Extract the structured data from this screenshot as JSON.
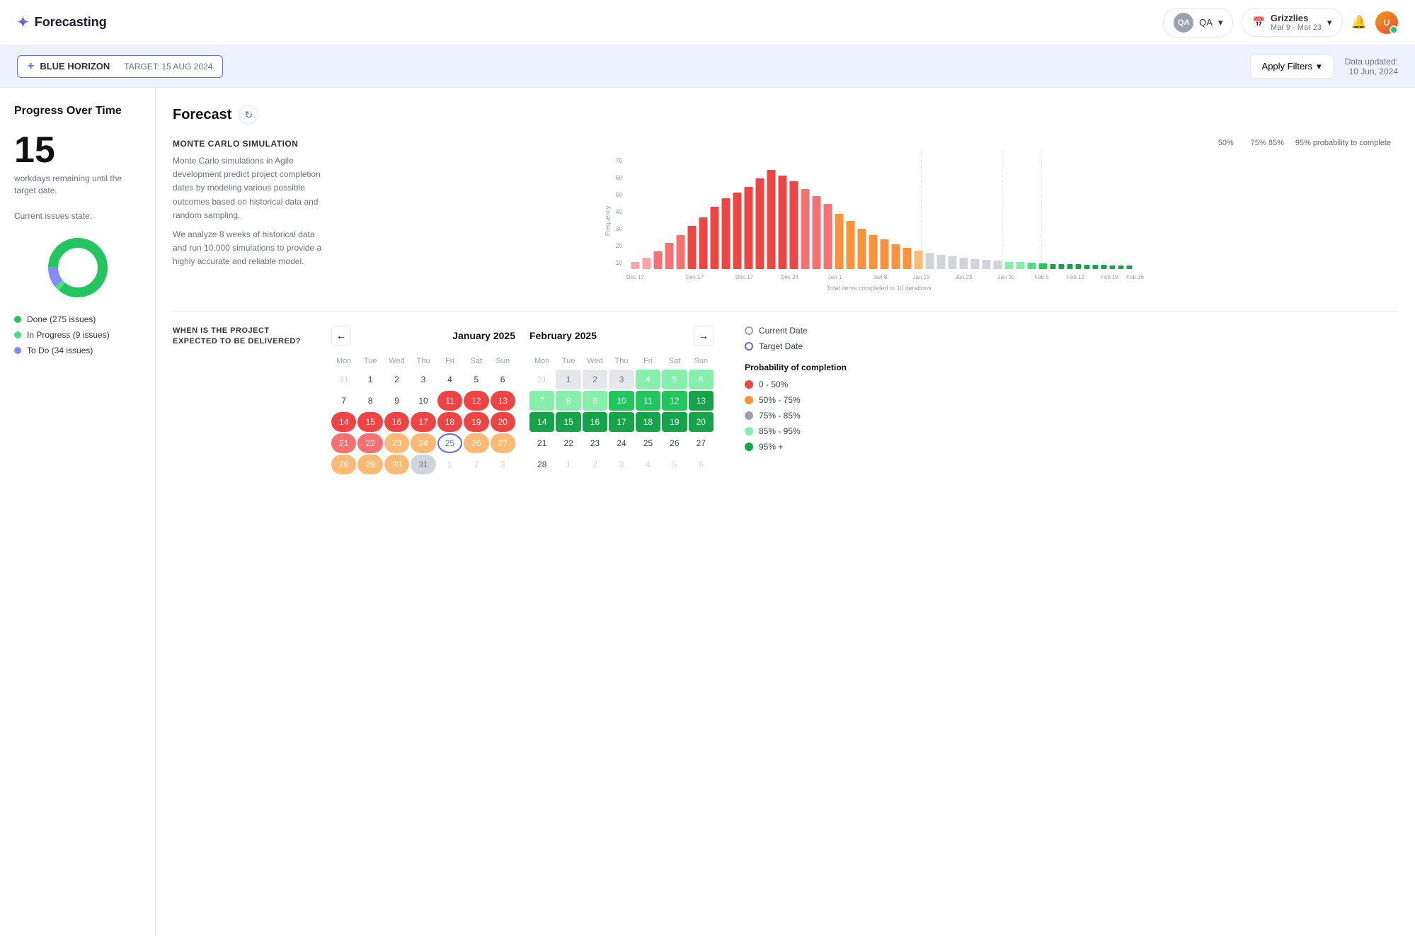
{
  "header": {
    "title": "Forecasting",
    "logo_icon": "✦",
    "team_avatar": "QA",
    "team_name": "QA",
    "calendar_icon": "📅",
    "project_name": "Grizzlies",
    "project_dates": "Mar 9 - Mar 23",
    "chevron_down": "▾"
  },
  "sub_header": {
    "plus_icon": "+",
    "project_tag": "BLUE HORIZON",
    "target_label": "TARGET: 15 AUG 2024",
    "apply_filters": "Apply Filters",
    "data_updated_label": "Data updated:",
    "data_updated_date": "10 Jun, 2024"
  },
  "left_panel": {
    "title": "Progress Over Time",
    "workdays_number": "15",
    "workdays_desc": "workdays remaining until the target date.",
    "current_issues_label": "Current issues state:",
    "legend": [
      {
        "color": "#22c55e",
        "label": "Done (275 issues)"
      },
      {
        "color": "#4ade80",
        "label": "In Progress (9 issues)"
      },
      {
        "color": "#818cf8",
        "label": "To Do (34 issues)"
      }
    ],
    "donut": {
      "done_pct": 86,
      "in_progress_pct": 3,
      "todo_pct": 11
    }
  },
  "forecast": {
    "title": "Forecast",
    "refresh_icon": "↻",
    "monte_carlo": {
      "title": "MONTE CARLO SIMULATION",
      "desc1": "Monte Carlo simulations in Agile development predict project completion dates by modeling various possible outcomes based on historical data and random sampling.",
      "desc2": "We analyze 8 weeks of historical data and run 10,000 simulations to provide a highly accurate and reliable model."
    },
    "chart": {
      "y_label": "Frequency",
      "x_label": "Total items completed in 10 iterations",
      "y_ticks": [
        70,
        60,
        50,
        40,
        30,
        20,
        10
      ],
      "x_labels": [
        "Dec 17",
        "Dec 17",
        "Dec 17",
        "Dec 24",
        "Jan 1",
        "Jan 8",
        "Jan 15",
        "Jan 23",
        "Jan 30",
        "Feb 5",
        "Feb 12",
        "Feb 19",
        "Feb 26"
      ],
      "probability_labels": [
        "50%",
        "75%",
        "85%",
        "95% probability to complete"
      ]
    },
    "delivery_section": {
      "question": "WHEN IS THE PROJECT EXPECTED TO BE DELIVERED?",
      "jan_2025": {
        "month": "January 2025",
        "days_header": [
          "Mon",
          "Tue",
          "Wed",
          "Thu",
          "Fri",
          "Sat",
          "Sun"
        ],
        "rows": [
          [
            "31",
            "1",
            "2",
            "3",
            "4",
            "5",
            "6"
          ],
          [
            "7",
            "8",
            "9",
            "10",
            "11",
            "12",
            "13"
          ],
          [
            "14",
            "15",
            "16",
            "17",
            "18",
            "19",
            "20"
          ],
          [
            "21",
            "22",
            "23",
            "24",
            "25",
            "26",
            "27"
          ],
          [
            "28",
            "29",
            "30",
            "31",
            "1",
            "2",
            "3"
          ]
        ]
      },
      "feb_2025": {
        "month": "February 2025",
        "days_header": [
          "Mon",
          "Tue",
          "Wed",
          "Thu",
          "Fri",
          "Sat",
          "Sun"
        ],
        "rows": [
          [
            "31",
            "1",
            "2",
            "3",
            "4",
            "5",
            "6"
          ],
          [
            "7",
            "8",
            "9",
            "10",
            "11",
            "12",
            "13"
          ],
          [
            "14",
            "15",
            "16",
            "17",
            "18",
            "19",
            "20"
          ],
          [
            "21",
            "22",
            "23",
            "24",
            "25",
            "26",
            "27"
          ],
          [
            "28",
            "1",
            "2",
            "3",
            "4",
            "5",
            "6"
          ]
        ]
      },
      "legend": {
        "current_date_label": "Current Date",
        "target_date_label": "Target Date",
        "probability_title": "Probability of completion",
        "items": [
          {
            "color": "#ef4444",
            "label": "0 - 50%"
          },
          {
            "color": "#fb923c",
            "label": "50% - 75%"
          },
          {
            "color": "#9ca3af",
            "label": "75% - 85%"
          },
          {
            "color": "#86efac",
            "label": "85% - 95%"
          },
          {
            "color": "#16a34a",
            "label": "95% +"
          }
        ]
      }
    }
  }
}
